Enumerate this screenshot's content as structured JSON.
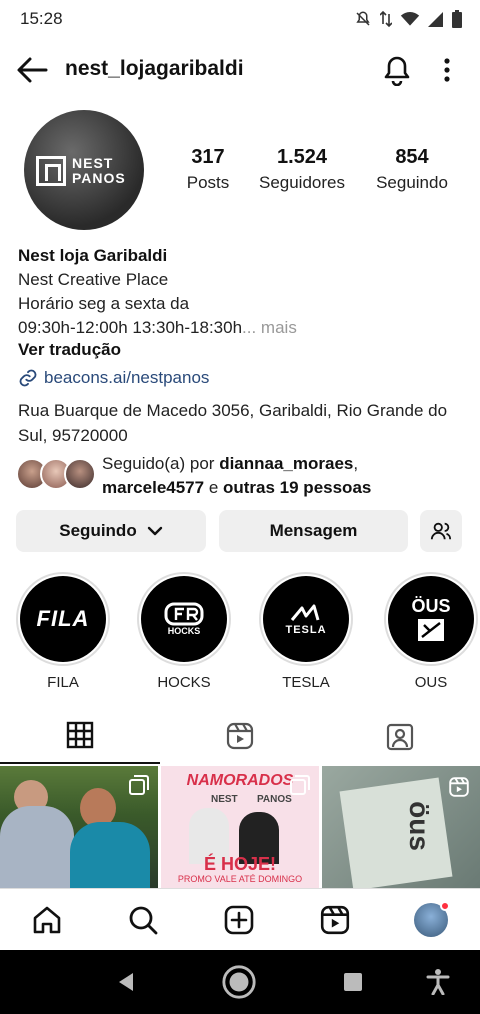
{
  "status_bar": {
    "time": "15:28"
  },
  "header": {
    "username": "nest_lojagaribaldi"
  },
  "profile": {
    "avatar_text": "NEST\nPANOS",
    "stats": [
      {
        "value": "317",
        "label": "Posts"
      },
      {
        "value": "1.524",
        "label": "Seguidores"
      },
      {
        "value": "854",
        "label": "Seguindo"
      }
    ],
    "name": "Nest loja Garibaldi",
    "bio_lines": [
      "Nest Creative Place",
      "Horário seg a sexta da",
      "09:30h-12:00h 13:30h-18:30h"
    ],
    "more": "... mais",
    "translate": "Ver tradução",
    "link": "beacons.ai/nestpanos",
    "address": "Rua Buarque de Macedo 3056, Garibaldi, Rio Grande do Sul, 95720000",
    "followed_prefix": "Seguido(a) por ",
    "followed_user1": "diannaa_moraes",
    "followed_comma": ",",
    "followed_user2": "marcele4577",
    "followed_and": " e ",
    "followed_others": "outras 19 pessoas"
  },
  "buttons": {
    "following": "Seguindo",
    "message": "Mensagem"
  },
  "highlights": [
    {
      "label": "FILA",
      "logo": "FILA"
    },
    {
      "label": "HOCKS",
      "logo": "HOCKS"
    },
    {
      "label": "TESLA",
      "logo": "TESLA"
    },
    {
      "label": "OUS",
      "logo": "ÖUS"
    }
  ],
  "grid_post2": {
    "line1": "NAMORADOS",
    "line2": "NEST",
    "line3": "PANOS",
    "line4": "É HOJE!",
    "line5": "PROMO VALE ATÉ DOMINGO"
  },
  "grid_post3": {
    "text": "öus"
  },
  "colors": {
    "accent_link": "#2a4a7a",
    "button_bg": "#efefef",
    "dark": "#000000"
  }
}
